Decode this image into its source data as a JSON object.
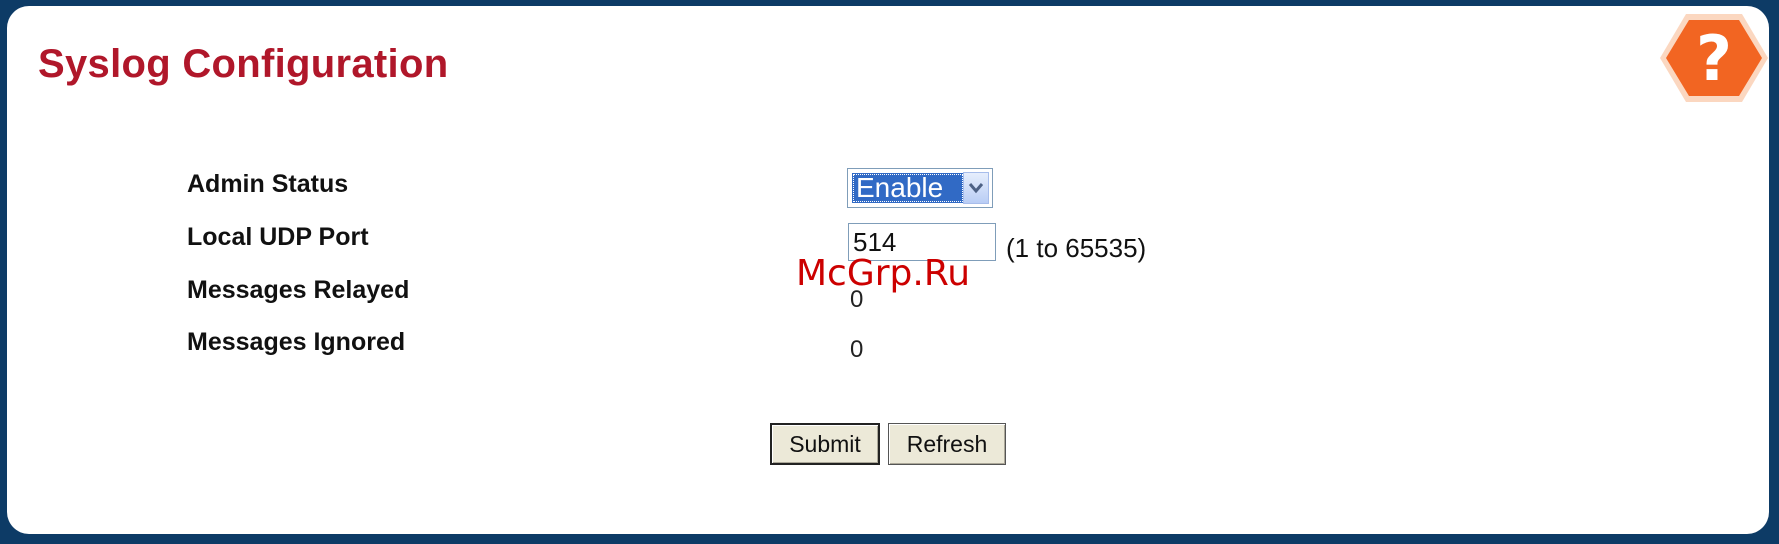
{
  "page": {
    "title": "Syslog Configuration"
  },
  "help": {
    "icon": "question-help-icon",
    "glyph": "?"
  },
  "form": {
    "admin_status": {
      "label": "Admin Status",
      "selected": "Enable",
      "options": [
        "Enable"
      ]
    },
    "local_udp_port": {
      "label": "Local UDP Port",
      "value": "514",
      "range": "(1 to 65535)"
    },
    "messages_relayed": {
      "label": "Messages Relayed",
      "value": "0"
    },
    "messages_ignored": {
      "label": "Messages Ignored",
      "value": "0"
    }
  },
  "buttons": {
    "submit": "Submit",
    "refresh": "Refresh"
  },
  "watermark": "McGrp.Ru",
  "colors": {
    "background": "#0d3b66",
    "title": "#b0172a",
    "help": "#f26522",
    "selection": "#316ac5"
  }
}
